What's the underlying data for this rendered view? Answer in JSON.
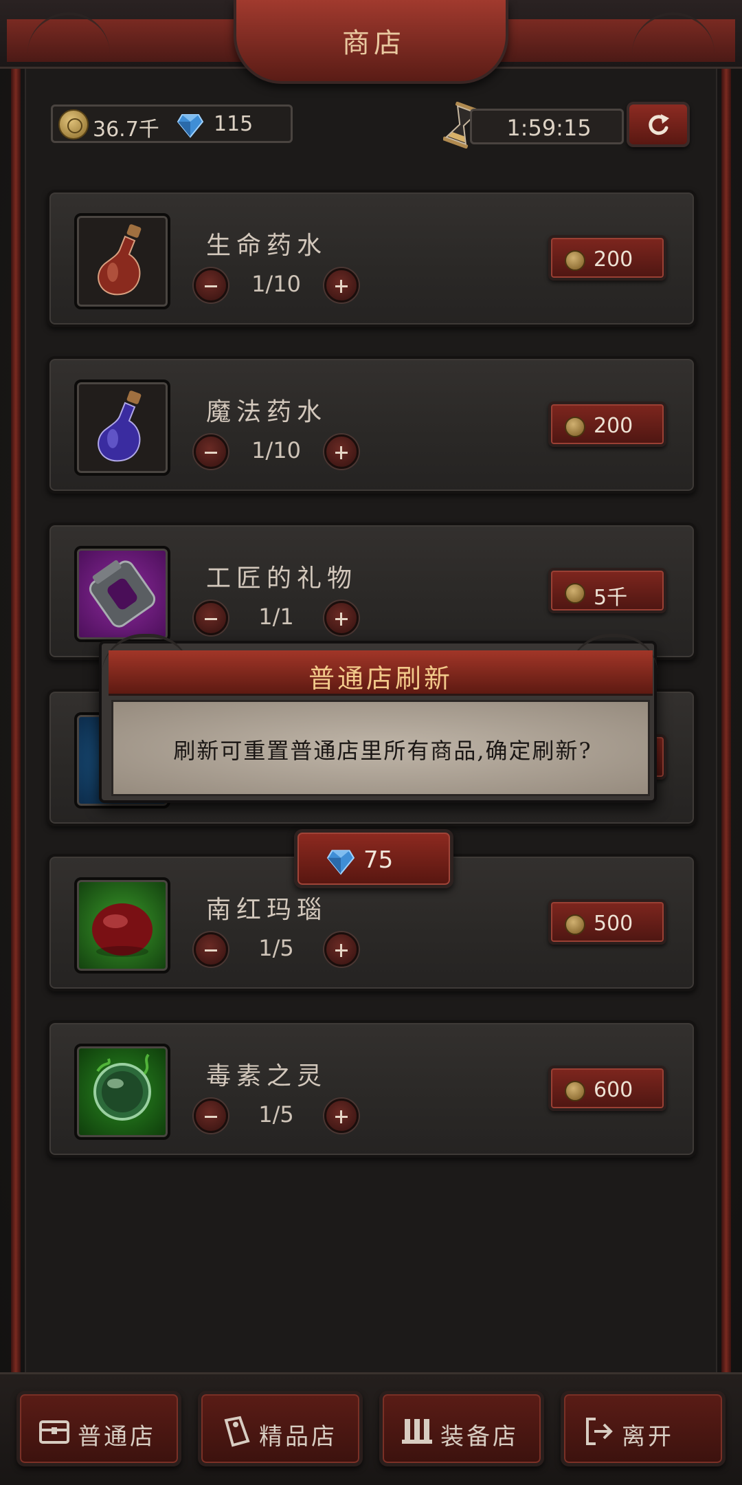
{
  "header": {
    "title": "商店"
  },
  "currency": {
    "gold": "36.7千",
    "gems": "115"
  },
  "timer": {
    "countdown": "1:59:15"
  },
  "items": [
    {
      "name": "生命药水",
      "quantity": "1/10",
      "price": "200",
      "icon": "red-potion-icon"
    },
    {
      "name": "魔法药水",
      "quantity": "1/10",
      "price": "200",
      "icon": "blue-potion-icon"
    },
    {
      "name": "工匠的礼物",
      "quantity": "1/1",
      "price": "5千",
      "icon": "iron-ring-icon"
    },
    {
      "name": "南红玛瑙",
      "quantity": "1/5",
      "price": "500",
      "icon": "red-agate-icon"
    },
    {
      "name": "毒素之灵",
      "quantity": "1/5",
      "price": "600",
      "icon": "toxic-orb-icon"
    }
  ],
  "modal": {
    "title": "普通店刷新",
    "message": "刷新可重置普通店里所有商品,确定刷新?",
    "confirm_cost": "75"
  },
  "nav": {
    "normal_shop": "普通店",
    "premium_shop": "精品店",
    "equipment_shop": "装备店",
    "leave": "离开"
  }
}
